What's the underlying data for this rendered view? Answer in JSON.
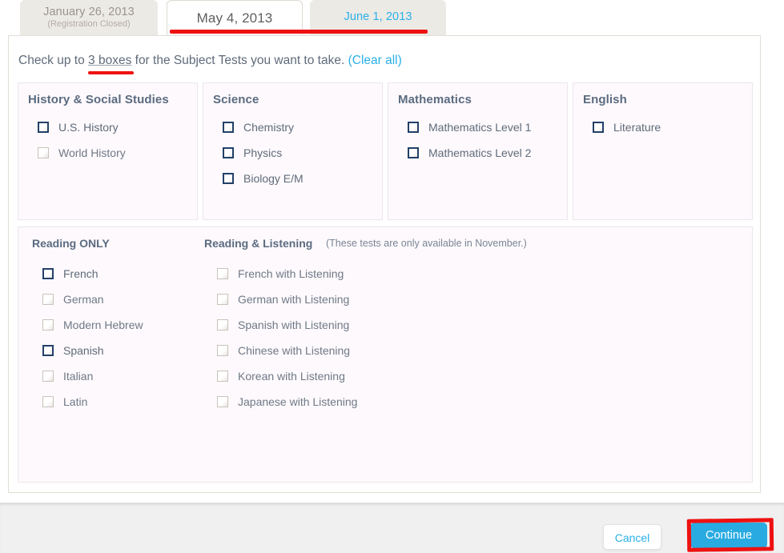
{
  "tabs": [
    {
      "date": "January 26, 2013",
      "sub": "(Registration Closed)",
      "state": "inactive-closed"
    },
    {
      "date": "May 4, 2013",
      "sub": "",
      "state": "active"
    },
    {
      "date": "June 1, 2013",
      "sub": "",
      "state": "inactive-link"
    }
  ],
  "instruction": {
    "prefix": "Check up to ",
    "emphasis": "3 boxes",
    "suffix": " for the Subject Tests you want to take. ",
    "clear_all": "(Clear all)"
  },
  "subjects": [
    {
      "title": "History & Social Studies",
      "items": [
        {
          "label": "U.S. History",
          "enabled": true,
          "checked": false
        },
        {
          "label": "World History",
          "enabled": false,
          "checked": false
        }
      ]
    },
    {
      "title": "Science",
      "items": [
        {
          "label": "Chemistry",
          "enabled": true,
          "checked": false
        },
        {
          "label": "Physics",
          "enabled": true,
          "checked": false
        },
        {
          "label": "Biology E/M",
          "enabled": true,
          "checked": false
        }
      ]
    },
    {
      "title": "Mathematics",
      "items": [
        {
          "label": "Mathematics Level 1",
          "enabled": true,
          "checked": false
        },
        {
          "label": "Mathematics Level 2",
          "enabled": true,
          "checked": false
        }
      ]
    },
    {
      "title": "English",
      "items": [
        {
          "label": "Literature",
          "enabled": true,
          "checked": false
        }
      ]
    }
  ],
  "languages": {
    "reading_only_title": "Reading ONLY",
    "reading_listening_title": "Reading & Listening",
    "note": "(These tests are only available in November.)",
    "reading_only": [
      {
        "label": "French",
        "enabled": true,
        "checked": false
      },
      {
        "label": "German",
        "enabled": false,
        "checked": false
      },
      {
        "label": "Modern Hebrew",
        "enabled": false,
        "checked": false
      },
      {
        "label": "Spanish",
        "enabled": true,
        "checked": false
      },
      {
        "label": "Italian",
        "enabled": false,
        "checked": false
      },
      {
        "label": "Latin",
        "enabled": false,
        "checked": false
      }
    ],
    "reading_listening": [
      {
        "label": "French with Listening",
        "enabled": false,
        "checked": false
      },
      {
        "label": "German with Listening",
        "enabled": false,
        "checked": false
      },
      {
        "label": "Spanish with Listening",
        "enabled": false,
        "checked": false
      },
      {
        "label": "Chinese with Listening",
        "enabled": false,
        "checked": false
      },
      {
        "label": "Korean with Listening",
        "enabled": false,
        "checked": false
      },
      {
        "label": "Japanese with Listening",
        "enabled": false,
        "checked": false
      }
    ]
  },
  "footer": {
    "cancel_label": "Cancel",
    "continue_label": "Continue"
  },
  "colors": {
    "accent_blue": "#29abe2",
    "link_blue": "#2ab0e8",
    "annotation_red": "#ee1111",
    "heading_slate": "#5b6b80",
    "checkbox_enabled_border": "#234069",
    "checkbox_disabled_border": "#c9c3ba",
    "panel_bg": "#ffffff",
    "box_bg": "#fdf9fc",
    "footer_bg": "#f0f0f0",
    "tab_inactive_bg": "#eceae5"
  }
}
